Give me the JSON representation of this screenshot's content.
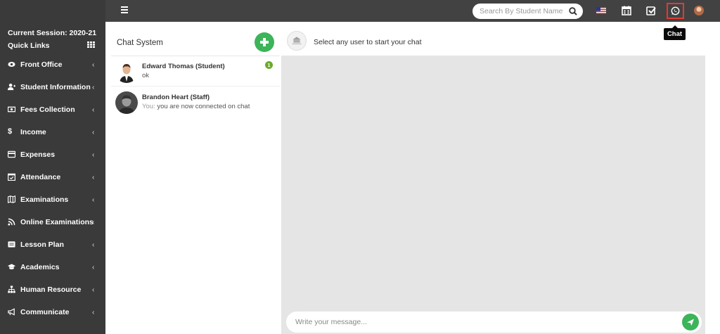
{
  "topbar": {
    "search_placeholder": "Search By Student Name",
    "tooltip": "Chat"
  },
  "sidebar": {
    "session": "Current Session: 2020-21",
    "quick_links": "Quick Links",
    "items": [
      {
        "label": "Front Office",
        "icon": "eye-icon"
      },
      {
        "label": "Student Information",
        "icon": "user-plus-icon"
      },
      {
        "label": "Fees Collection",
        "icon": "money-icon"
      },
      {
        "label": "Income",
        "icon": "dollar-icon"
      },
      {
        "label": "Expenses",
        "icon": "credit-card-icon"
      },
      {
        "label": "Attendance",
        "icon": "calendar-check-icon"
      },
      {
        "label": "Examinations",
        "icon": "map-icon"
      },
      {
        "label": "Online Examinations",
        "icon": "rss-icon"
      },
      {
        "label": "Lesson Plan",
        "icon": "list-icon"
      },
      {
        "label": "Academics",
        "icon": "graduation-cap-icon"
      },
      {
        "label": "Human Resource",
        "icon": "sitemap-icon"
      },
      {
        "label": "Communicate",
        "icon": "bullhorn-icon"
      }
    ]
  },
  "chat_list": {
    "title": "Chat System",
    "contacts": [
      {
        "name": "Edward Thomas (Student)",
        "prefix": "",
        "message": "ok",
        "badge": "1"
      },
      {
        "name": "Brandon Heart (Staff)",
        "prefix": "You:",
        "message": "you are now connected on chat",
        "badge": ""
      }
    ]
  },
  "conversation": {
    "title": "Select any user to start your chat",
    "input_placeholder": "Write your message..."
  },
  "colors": {
    "topbar": "#424242",
    "sidebar": "#3a3a3a",
    "accent_green": "#3cb45a",
    "highlight_red": "#e53935"
  }
}
